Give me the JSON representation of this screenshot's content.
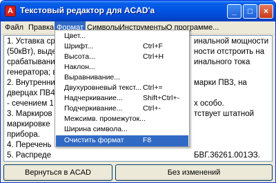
{
  "window": {
    "title": "Текстовый редактор для ACAD'а",
    "app_icon_letter": "A"
  },
  "titlebar_buttons": {
    "minimize": "_",
    "maximize": "□",
    "close": "×"
  },
  "menubar": {
    "items": [
      "Файл",
      "Правка",
      "Формат",
      "Символы",
      "Инструменты",
      "О программе..."
    ]
  },
  "document": {
    "lines": [
      "1. Уставка ср",
      "(50кВт), выде",
      "срабатывание",
      "генератора; в",
      "2. Внутренни",
      "дверцах ПВ4",
      "- сечением 1",
      "3. Маркиров",
      "маркировке",
      "прибора.",
      "4. Перечень",
      "5. Распреде"
    ],
    "right_fragments": [
      "инальной мощности",
      "ности отстроить на",
      "инального тока",
      "",
      "марки ПВ3, на",
      "",
      "х особо.",
      "тствует штатной",
      "",
      "",
      "",
      "БВГ.36261.001ЭЗ."
    ]
  },
  "format_menu": {
    "items": [
      {
        "label": "Цвет...",
        "shortcut": ""
      },
      {
        "label": "Шрифт...",
        "shortcut": "Ctrl+F"
      },
      {
        "label": "Высота...",
        "shortcut": "Ctrl+H"
      },
      {
        "label": "Наклон...",
        "shortcut": ""
      },
      {
        "label": "Выравнивание...",
        "shortcut": ""
      },
      {
        "label": "Двухуровневый текст...",
        "shortcut": "Ctrl+="
      },
      {
        "label": "Надчеркивание...",
        "shortcut": "Shift+Ctrl+-"
      },
      {
        "label": "Подчеркивание...",
        "shortcut": "Ctrl+-"
      },
      {
        "label": "Межсимв. промежуток...",
        "shortcut": ""
      },
      {
        "label": "Ширина символа...",
        "shortcut": ""
      }
    ],
    "clear": {
      "label": "Очистить формат",
      "shortcut": "F8"
    }
  },
  "buttons": {
    "return": "Вернуться в ACAD",
    "no_change": "Без изменений"
  },
  "colors": {
    "title_blue": "#0054e3",
    "menu_highlight": "#316ac5",
    "window_bg": "#ece9d8"
  }
}
